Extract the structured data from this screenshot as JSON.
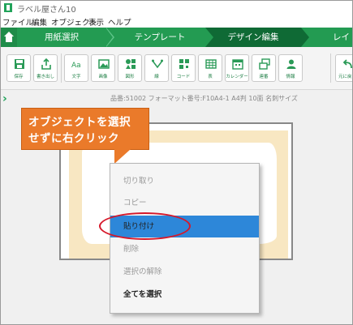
{
  "window": {
    "title": "ラベル屋さん10"
  },
  "menubar": [
    "ファイル",
    "編集",
    "オブジェクト",
    "表示",
    "ヘルプ"
  ],
  "steps": [
    {
      "label": "用紙選択",
      "active": false
    },
    {
      "label": "テンプレート",
      "active": false
    },
    {
      "label": "デザイン編集",
      "active": true
    },
    {
      "label": "レイ",
      "active": false
    }
  ],
  "toolbar": {
    "buttons": [
      {
        "label": "保存",
        "icon": "save-icon"
      },
      {
        "label": "書き出し",
        "icon": "export-icon"
      },
      {
        "label": "文字",
        "icon": "text-icon"
      },
      {
        "label": "画像",
        "icon": "image-icon"
      },
      {
        "label": "図形",
        "icon": "shape-icon"
      },
      {
        "label": "線",
        "icon": "line-icon"
      },
      {
        "label": "コード",
        "icon": "barcode-icon"
      },
      {
        "label": "表",
        "icon": "table-icon"
      },
      {
        "label": "カレンダー",
        "icon": "calendar-icon"
      },
      {
        "label": "連番",
        "icon": "serial-icon"
      },
      {
        "label": "情報",
        "icon": "person-icon"
      },
      {
        "label": "元に戻す",
        "icon": "undo-icon"
      }
    ]
  },
  "canvas": {
    "info": "品番:51002 フォーマット番号:F10A4-1 A4判 10面 名刺サイズ"
  },
  "callout": {
    "line1": "オブジェクトを選択",
    "line2": "せずに右クリック"
  },
  "context_menu": {
    "items": [
      {
        "label": "切り取り",
        "enabled": false
      },
      {
        "label": "コピー",
        "enabled": false
      },
      {
        "label": "貼り付け",
        "enabled": true,
        "highlighted": true
      },
      {
        "label": "削除",
        "enabled": false
      },
      {
        "label": "選択の解除",
        "enabled": false
      },
      {
        "label": "全てを選択",
        "enabled": true
      }
    ]
  },
  "colors": {
    "brand_green": "#239b52",
    "active_step": "#0f6a35",
    "callout": "#ea7a2a",
    "highlight": "#2d87d9",
    "ring": "#d6182a",
    "card": "#f8e7c2"
  }
}
